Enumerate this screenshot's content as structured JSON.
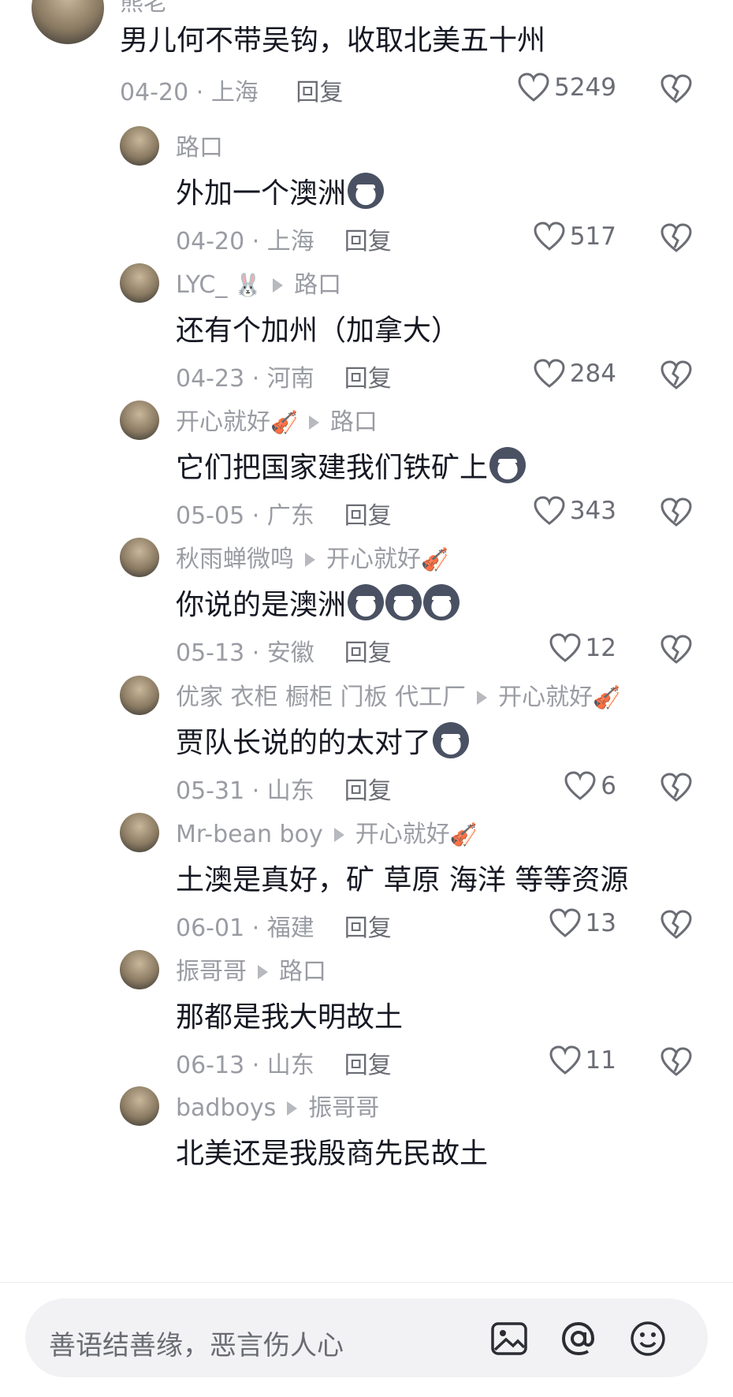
{
  "top_comment": {
    "username": "熊老",
    "text": "男儿何不带吴钩，收取北美五十州",
    "date": "04-20",
    "location": "上海",
    "reply_label": "回复",
    "likes": "5249"
  },
  "replies": [
    {
      "username": "路口",
      "reply_to": "",
      "text": "外加一个澳洲",
      "emoji_count": 1,
      "date": "04-20",
      "location": "上海",
      "reply_label": "回复",
      "likes": "517"
    },
    {
      "username": "LYC_",
      "reply_to": "路口",
      "text": "还有个加州（加拿大）",
      "emoji_count": 0,
      "date": "04-23",
      "location": "河南",
      "reply_label": "回复",
      "likes": "284"
    },
    {
      "username": "开心就好",
      "reply_to": "路口",
      "text": "它们把国家建我们铁矿上",
      "emoji_count": 1,
      "date": "05-05",
      "location": "广东",
      "reply_label": "回复",
      "likes": "343"
    },
    {
      "username": "秋雨蝉微鸣",
      "reply_to": "开心就好",
      "text": "你说的是澳洲",
      "emoji_count": 3,
      "date": "05-13",
      "location": "安徽",
      "reply_label": "回复",
      "likes": "12"
    },
    {
      "username": "优家 衣柜 橱柜 门板 代工厂",
      "reply_to": "开心就好",
      "text": "贾队长说的的太对了",
      "emoji_count": 1,
      "date": "05-31",
      "location": "山东",
      "reply_label": "回复",
      "likes": "6"
    },
    {
      "username": "Mr-bean boy",
      "reply_to": "开心就好",
      "text": "土澳是真好，矿 草原  海洋 等等资源",
      "emoji_count": 0,
      "date": "06-01",
      "location": "福建",
      "reply_label": "回复",
      "likes": "13"
    },
    {
      "username": "振哥哥",
      "reply_to": "路口",
      "text": "那都是我大明故土",
      "emoji_count": 0,
      "date": "06-13",
      "location": "山东",
      "reply_label": "回复",
      "likes": "11"
    },
    {
      "username": "badboys",
      "reply_to": "振哥哥",
      "text": "北美还是我殷商先民故土",
      "emoji_count": 0,
      "date": "",
      "location": "",
      "reply_label": "",
      "likes": ""
    }
  ],
  "input": {
    "placeholder": "善语结善缘，恶言伤人心",
    "icons": [
      "image-icon",
      "at-icon",
      "emoji-icon"
    ]
  },
  "colors": {
    "text_primary": "#161823",
    "text_secondary": "#9a9ca3",
    "input_bg": "#f2f2f4"
  }
}
